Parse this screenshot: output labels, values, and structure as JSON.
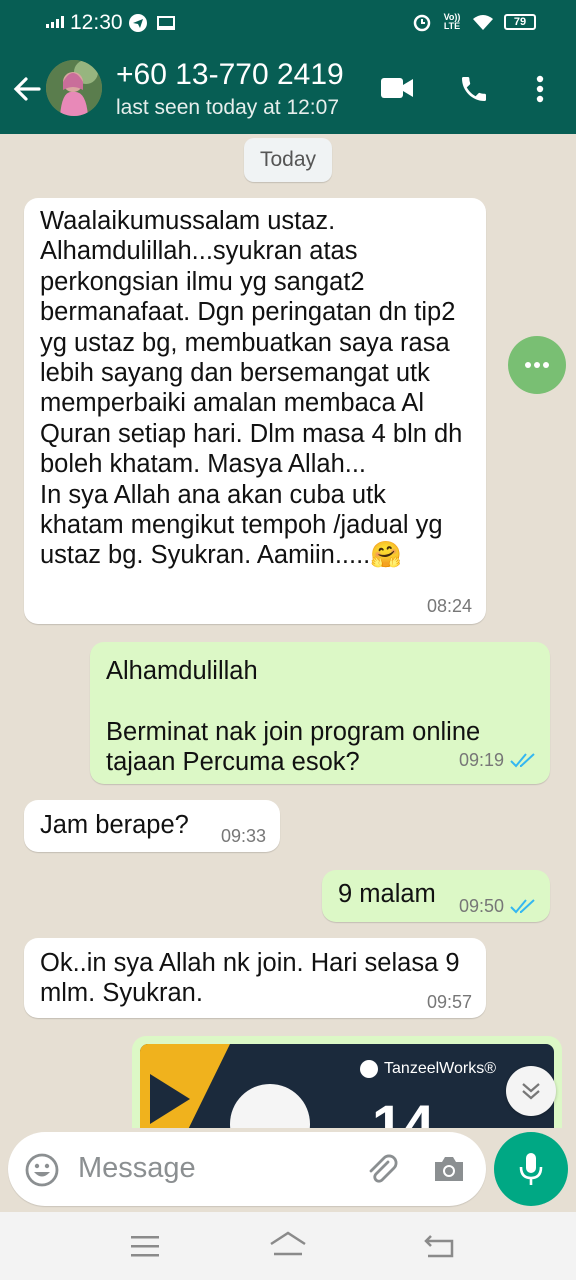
{
  "status_bar": {
    "time": "12:30",
    "volte_label": "Vo)) LTE",
    "battery": "79"
  },
  "app_bar": {
    "contact_name": "+60 13-770 2419",
    "contact_status": "last seen today at 12:07"
  },
  "chat": {
    "date_chip": "Today",
    "messages": [
      {
        "direction": "incoming",
        "text": "Waalaikumussalam ustaz.\nAlhamdulillah...syukran atas\nperkongsian ilmu yg sangat2\nbermanafaat. Dgn peringatan dn tip2\nyg ustaz bg, membuatkan saya rasa\nlebih sayang dan bersemangat utk\nmemperbaiki amalan membaca Al\nQuran setiap hari. Dlm masa 4 bln dh\nboleh khatam. Masya Allah...\nIn sya Allah ana akan cuba utk\nkhatam mengikut tempoh /jadual yg\nustaz bg. Syukran. Aamiin.....🤗",
        "time": "08:24"
      },
      {
        "direction": "outgoing",
        "text": "Alhamdulillah\n\nBerminat nak join program online\ntajaan Percuma esok?",
        "time": "09:19",
        "status": "read"
      },
      {
        "direction": "incoming",
        "text": "Jam berape?",
        "time": "09:33"
      },
      {
        "direction": "outgoing",
        "text": "9 malam",
        "time": "09:50",
        "status": "read"
      },
      {
        "direction": "incoming",
        "text": "Ok..in sya Allah nk join. Hari selasa 9\nmlm. Syukran.",
        "time": "09:57"
      }
    ],
    "image_message": {
      "brand_text": "TanzeelWorks®",
      "big_number": "14"
    }
  },
  "input_bar": {
    "placeholder": "Message"
  },
  "colors": {
    "header": "#075e54",
    "outgoing_bubble": "#dcf8c6",
    "incoming_bubble": "#ffffff",
    "read_ticks": "#34b7f1",
    "mic_button": "#00a884"
  }
}
